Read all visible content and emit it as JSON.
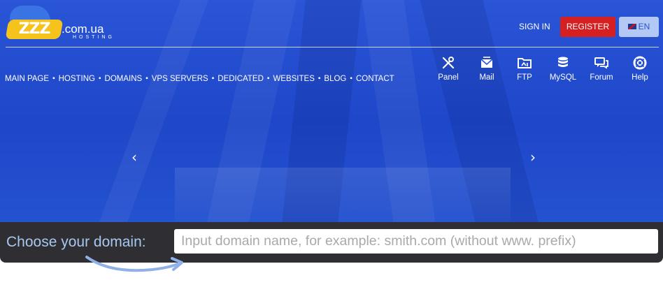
{
  "header": {
    "logo": {
      "mark": "ZZZ",
      "domain": ".com.ua",
      "tagline": "HOSTING"
    },
    "sign_in": "SIGN IN",
    "register": "REGISTER",
    "language": "EN"
  },
  "nav": {
    "items": [
      "MAIN PAGE",
      "HOSTING",
      "DOMAINS",
      "VPS SERVERS",
      "DEDICATED",
      "WEBSITES",
      "BLOG",
      "CONTACT"
    ],
    "separator": "▪"
  },
  "tools": [
    {
      "label": "Panel",
      "icon": "tools-icon"
    },
    {
      "label": "Mail",
      "icon": "mail-icon"
    },
    {
      "label": "FTP",
      "icon": "folder-icon"
    },
    {
      "label": "MySQL",
      "icon": "database-icon"
    },
    {
      "label": "Forum",
      "icon": "chat-icon"
    },
    {
      "label": "Help",
      "icon": "lifebuoy-icon"
    }
  ],
  "slider": {
    "prev": "‹",
    "next": "›"
  },
  "domain_search": {
    "label": "Choose your domain:",
    "placeholder": "Input domain name, for example: smith.com (without www. prefix)",
    "value": ""
  },
  "colors": {
    "hero_blue": "#2a55d6",
    "register_red": "#d42020",
    "domain_bar": "#2e2e33",
    "label_blue": "#a8c8f0",
    "logo_yellow": "#f6c21c"
  }
}
